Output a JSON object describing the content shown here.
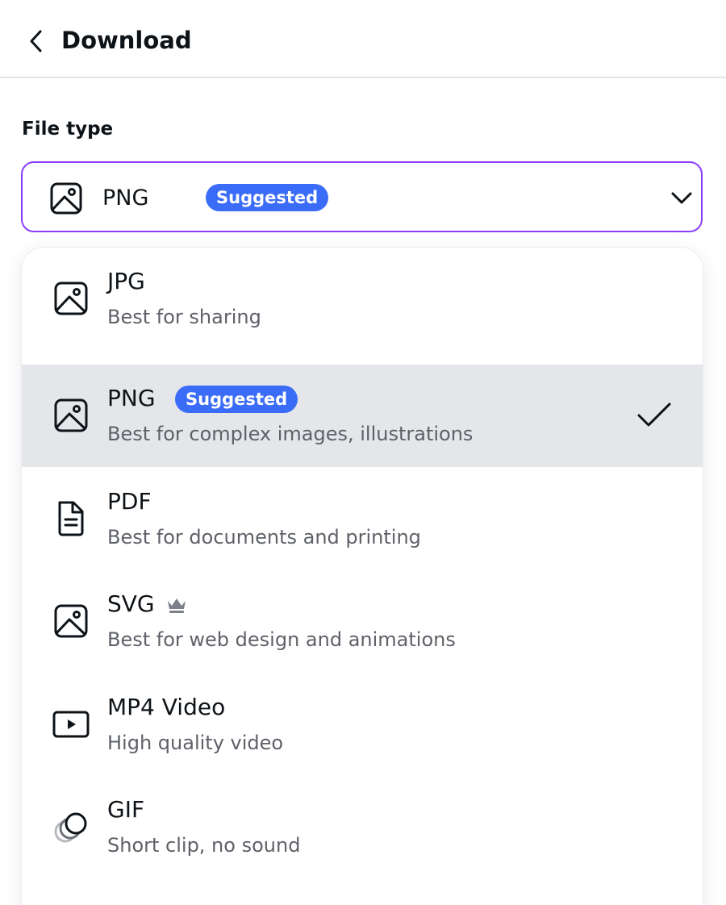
{
  "header": {
    "title": "Download",
    "back_icon": "chevron-left-icon"
  },
  "file_type": {
    "label": "File type",
    "selected_value": "PNG",
    "selected_badge": "Suggested",
    "selected_icon": "image-icon",
    "chevron_icon": "chevron-down-icon",
    "accent_color": "#8b3dff",
    "badge_color": "#3a6cf7"
  },
  "options": [
    {
      "name": "JPG",
      "desc": "Best for sharing",
      "icon": "image-icon"
    },
    {
      "name": "PNG",
      "badge": "Suggested",
      "desc": "Best for complex images, illustrations",
      "icon": "image-icon",
      "selected": true
    },
    {
      "name": "PDF",
      "desc": "Best for documents and printing",
      "icon": "document-icon"
    },
    {
      "name": "SVG",
      "desc": "Best for web design and animations",
      "icon": "image-icon",
      "premium_icon": "crown-icon"
    },
    {
      "name": "MP4 Video",
      "desc": "High quality video",
      "icon": "video-icon"
    },
    {
      "name": "GIF",
      "desc": "Short clip, no sound",
      "icon": "gif-icon"
    }
  ]
}
